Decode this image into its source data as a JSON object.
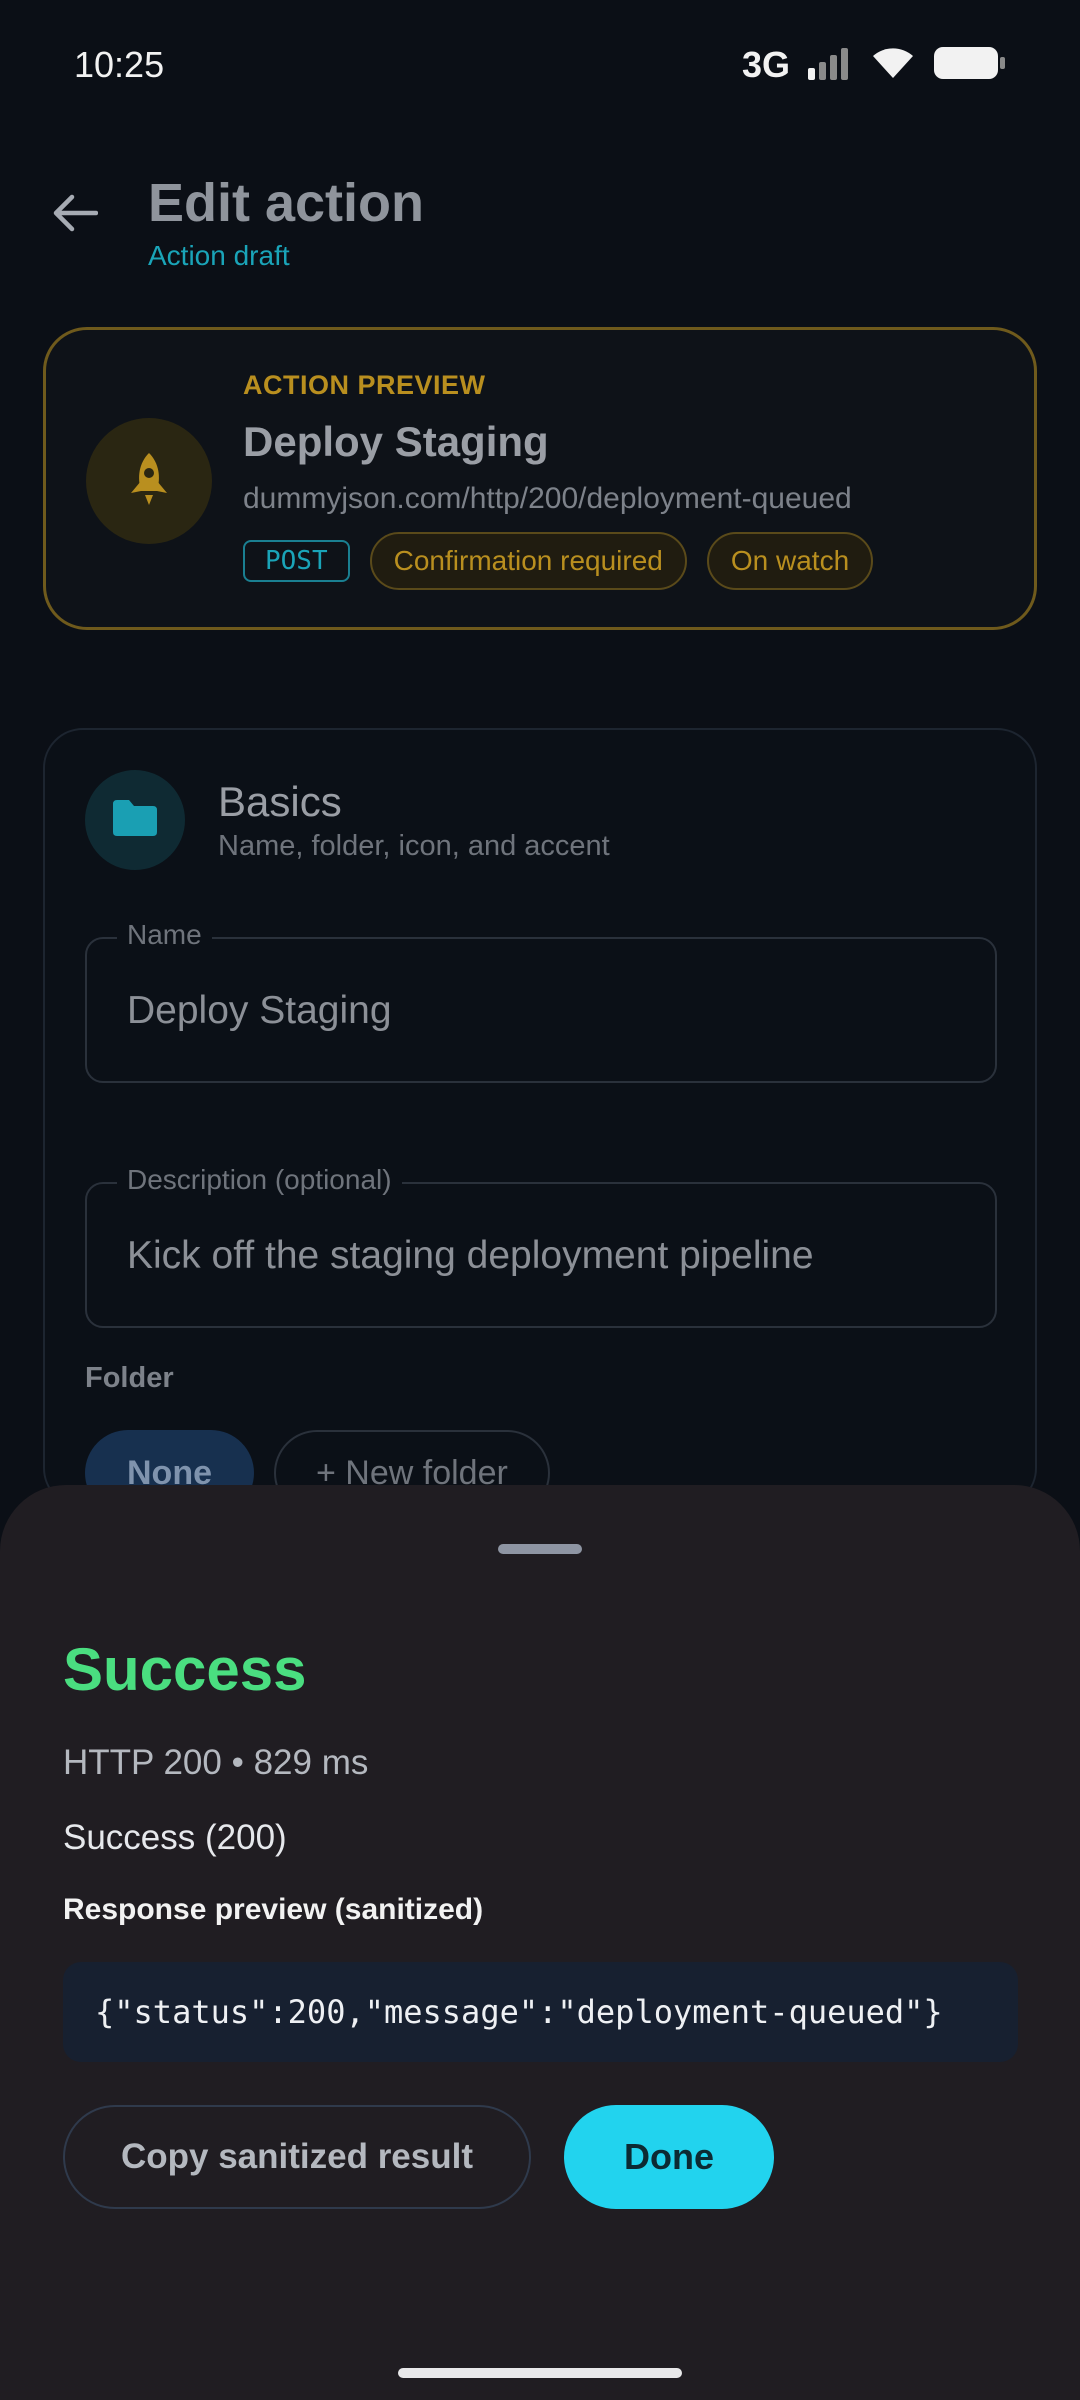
{
  "status_bar": {
    "time": "10:25",
    "network": "3G",
    "icons": [
      "signal-icon",
      "wifi-icon",
      "battery-icon"
    ]
  },
  "header": {
    "title": "Edit action",
    "subtitle": "Action draft",
    "back_icon": "arrow-left-icon"
  },
  "preview": {
    "kicker": "ACTION PREVIEW",
    "name": "Deploy Staging",
    "url": "dummyjson.com/http/200/deployment-queued",
    "method": "POST",
    "tags": [
      "Confirmation required",
      "On watch"
    ],
    "icon": "rocket-icon",
    "accent_color": "#b98f1f"
  },
  "basics": {
    "title": "Basics",
    "subtitle": "Name, folder, icon, and accent",
    "icon": "folder-icon",
    "name_field": {
      "label": "Name",
      "value": "Deploy Staging"
    },
    "description_field": {
      "label": "Description (optional)",
      "value": "Kick off the staging deployment pipeline"
    },
    "folder_label": "Folder",
    "folder_options": [
      "None",
      "+ New folder"
    ],
    "selected_folder": "None"
  },
  "result_sheet": {
    "title": "Success",
    "meta": "HTTP 200 • 829 ms",
    "status_text": "Success (200)",
    "preview_label": "Response preview (sanitized)",
    "response_preview": "{\"status\":200,\"message\":\"deployment-queued\"}",
    "copy_button": "Copy sanitized result",
    "done_button": "Done",
    "success_color": "#4ade80",
    "accent_color": "#22d3ee"
  }
}
